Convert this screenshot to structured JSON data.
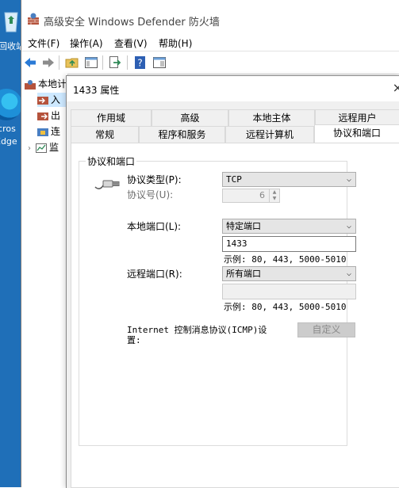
{
  "desktop": {
    "recycle_label": "回收站",
    "edge_label_line1": "icros",
    "edge_label_line2": "Edge"
  },
  "window": {
    "title": "高级安全 Windows Defender 防火墙"
  },
  "menu": [
    "文件(F)",
    "操作(A)",
    "查看(V)",
    "帮助(H)"
  ],
  "tree": {
    "root": "本地计",
    "items": [
      "入",
      "出",
      "连",
      "监"
    ]
  },
  "dialog": {
    "title": "1433 属性",
    "close": "×",
    "tabs_row1": [
      "作用域",
      "高级",
      "本地主体",
      "远程用户"
    ],
    "tabs_row2": [
      "常规",
      "程序和服务",
      "远程计算机",
      "协议和端口"
    ],
    "group_caption": "协议和端口",
    "protocol_type_label": "协议类型(P):",
    "protocol_type_value": "TCP",
    "protocol_number_label": "协议号(U):",
    "protocol_number_value": "6",
    "local_port_label": "本地端口(L):",
    "local_port_value": "特定端口",
    "local_port_text": "1433",
    "local_example": "示例: 80, 443, 5000-5010",
    "remote_port_label": "远程端口(R):",
    "remote_port_value": "所有端口",
    "remote_port_text": "",
    "remote_example": "示例: 80, 443, 5000-5010",
    "icmp_label_line1": "Internet 控制消息协议(ICMP)设",
    "icmp_label_line2": "置:",
    "customize_button": "自定义"
  }
}
